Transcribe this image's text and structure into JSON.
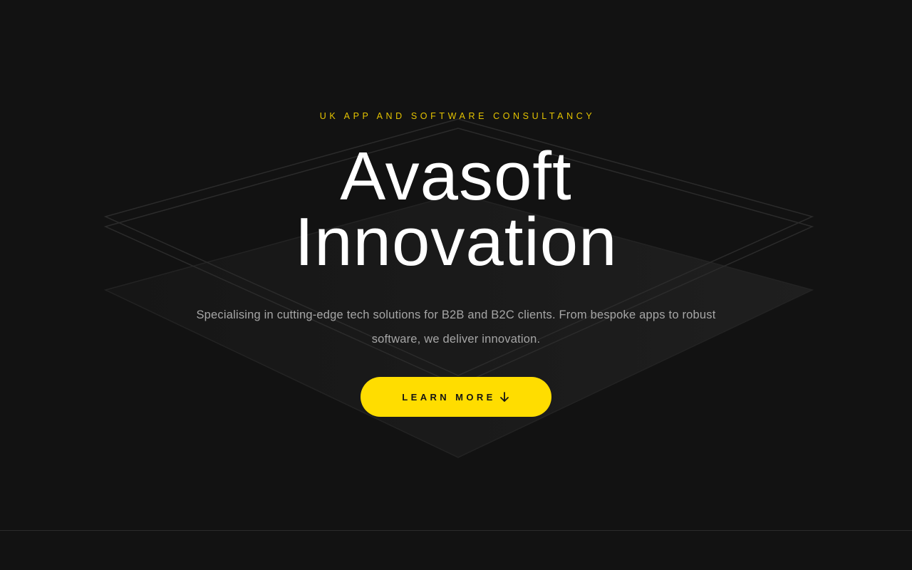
{
  "hero": {
    "eyebrow": "UK APP AND SOFTWARE CONSULTANCY",
    "title_line1": "Avasoft",
    "title_line2": "Innovation",
    "subtitle": "Specialising in cutting-edge tech solutions for B2B and B2C clients. From bespoke apps to robust software, we deliver innovation.",
    "cta_label": "LEARN MORE",
    "cta_icon": "arrow-down-icon"
  },
  "colors": {
    "background": "#121212",
    "accent": "#ffdd00",
    "eyebrow": "#e5c400",
    "title": "#ffffff",
    "subtitle": "#a6a6a6"
  }
}
